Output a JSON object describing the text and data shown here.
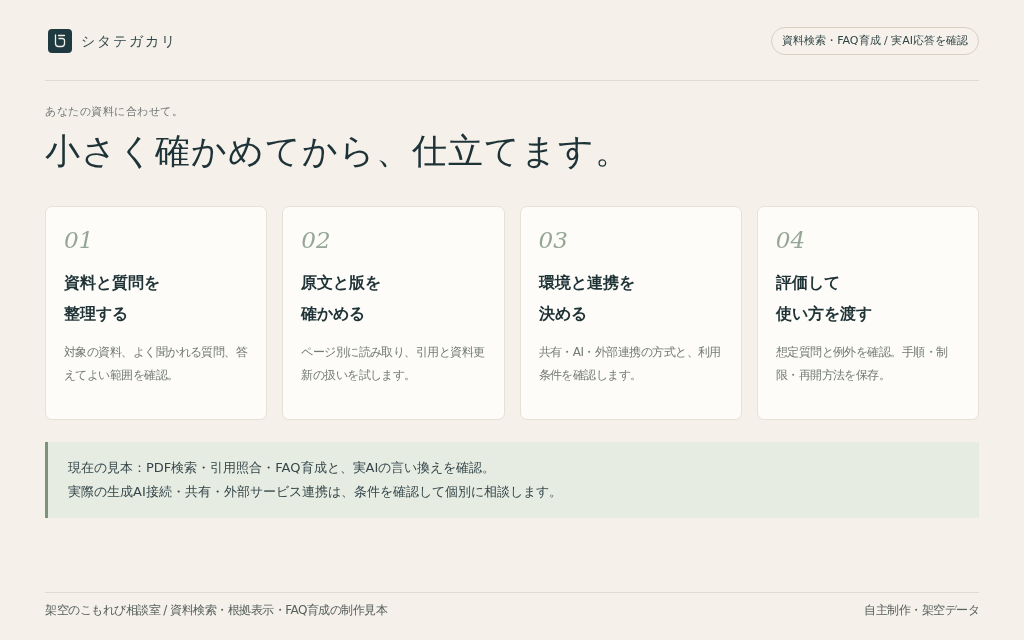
{
  "header": {
    "brand": "シタテガカリ",
    "badge": "資料検索・FAQ育成 / 実AI応答を確認"
  },
  "hero": {
    "eyebrow": "あなたの資料に合わせて。",
    "title": "小さく確かめてから、仕立てます。"
  },
  "steps": [
    {
      "number": "01",
      "title_lines": [
        "資料と質問を",
        "整理する"
      ],
      "description": "対象の資料、よく聞かれる質問、答えてよい範囲を確認。"
    },
    {
      "number": "02",
      "title_lines": [
        "原文と版を",
        "確かめる"
      ],
      "description": "ページ別に読み取り、引用と資料更新の扱いを試します。"
    },
    {
      "number": "03",
      "title_lines": [
        "環境と連携を",
        "決める"
      ],
      "description": "共有・AI・外部連携の方式と、利用条件を確認します。"
    },
    {
      "number": "04",
      "title_lines": [
        "評価して",
        "使い方を渡す"
      ],
      "description": "想定質問と例外を確認。手順・制限・再開方法を保存。"
    }
  ],
  "note": {
    "lines": [
      "現在の見本：PDF検索・引用照合・FAQ育成と、実AIの言い換えを確認。",
      "実際の生成AI接続・共有・外部サービス連携は、条件を確認して個別に相談します。"
    ]
  },
  "footer": {
    "left": "架空のこもれび相談室 / 資料検索・根拠表示・FAQ育成の制作見本",
    "right": "自主制作・架空データ"
  }
}
